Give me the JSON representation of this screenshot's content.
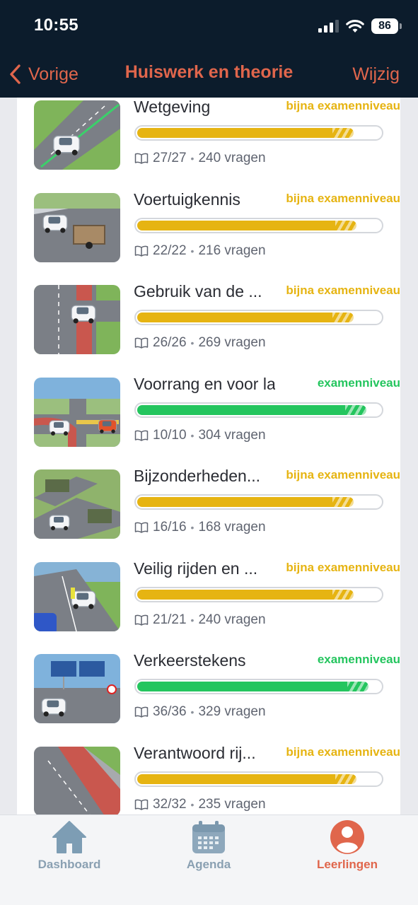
{
  "status_bar": {
    "time": "10:55",
    "battery": "86"
  },
  "nav": {
    "back_label": "Vorige",
    "title": "Huiswerk en theorie",
    "edit_label": "Wijzig"
  },
  "colors": {
    "accent": "#e0664c",
    "near_exam": "#e6b412",
    "exam": "#24c55e",
    "header_bg": "#0c1c2c"
  },
  "topics": [
    {
      "title": "Wetgeving",
      "level": "bijna examenniveau",
      "status": "near",
      "progress": 0.88,
      "chapters": "27/27",
      "questions": "240 vragen"
    },
    {
      "title": "Voertuigkennis",
      "level": "bijna examenniveau",
      "status": "near",
      "progress": 0.89,
      "chapters": "22/22",
      "questions": "216 vragen"
    },
    {
      "title": "Gebruik van de ...",
      "level": "bijna examenniveau",
      "status": "near",
      "progress": 0.88,
      "chapters": "26/26",
      "questions": "269 vragen"
    },
    {
      "title": "Voorrang en voor la...",
      "level": "examenniveau",
      "status": "exam",
      "progress": 0.93,
      "chapters": "10/10",
      "questions": "304 vragen"
    },
    {
      "title": "Bijzonderheden...",
      "level": "bijna examenniveau",
      "status": "near",
      "progress": 0.88,
      "chapters": "16/16",
      "questions": "168 vragen"
    },
    {
      "title": "Veilig rijden en ...",
      "level": "bijna examenniveau",
      "status": "near",
      "progress": 0.88,
      "chapters": "21/21",
      "questions": "240 vragen"
    },
    {
      "title": "Verkeerstekens",
      "level": "examenniveau",
      "status": "exam",
      "progress": 0.94,
      "chapters": "36/36",
      "questions": "329 vragen"
    },
    {
      "title": "Verantwoord rij...",
      "level": "bijna examenniveau",
      "status": "near",
      "progress": 0.89,
      "chapters": "32/32",
      "questions": "235 vragen"
    }
  ],
  "tabs": [
    {
      "label": "Dashboard",
      "icon": "home-icon",
      "active": false
    },
    {
      "label": "Agenda",
      "icon": "calendar-icon",
      "active": false
    },
    {
      "label": "Leerlingen",
      "icon": "person-icon",
      "active": true
    }
  ]
}
